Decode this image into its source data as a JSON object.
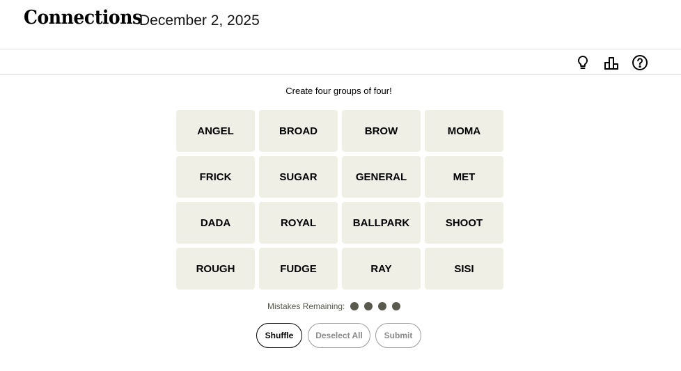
{
  "header": {
    "title": "Connections",
    "date": "December 2, 2025"
  },
  "toolbar": {
    "icons": [
      "lightbulb-icon",
      "leaderboard-icon",
      "help-icon"
    ]
  },
  "game": {
    "instructions": "Create four groups of four!",
    "tiles": [
      "ANGEL",
      "BROAD",
      "BROW",
      "MOMA",
      "FRICK",
      "SUGAR",
      "GENERAL",
      "MET",
      "DADA",
      "ROYAL",
      "BALLPARK",
      "SHOOT",
      "ROUGH",
      "FUDGE",
      "RAY",
      "SISI"
    ],
    "mistakes_label": "Mistakes Remaining:",
    "mistakes_remaining": 4
  },
  "controls": {
    "shuffle_label": "Shuffle",
    "deselect_label": "Deselect All",
    "submit_label": "Submit"
  },
  "colors": {
    "tile_bg": "#efefe6",
    "dot": "#5a594e"
  }
}
